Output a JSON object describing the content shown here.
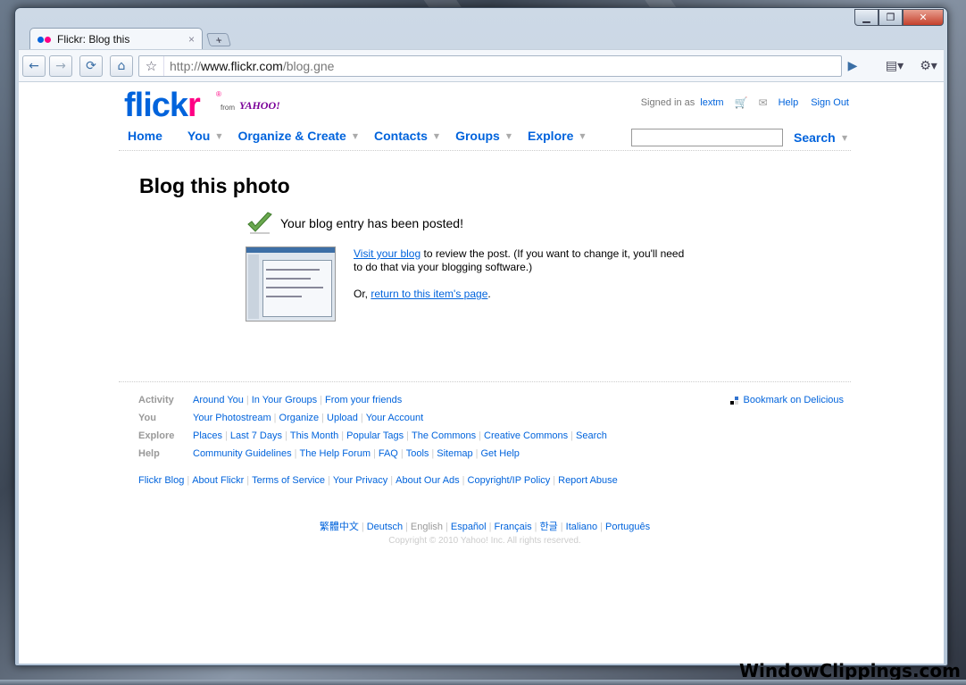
{
  "browser": {
    "tab_title": "Flickr: Blog this",
    "tab_close": "×",
    "new_tab": "+",
    "url_prefix": "http://",
    "url_host": "www.flickr.com",
    "url_path": "/blog.gne",
    "win_min": "▁",
    "win_max": "❐",
    "win_close": "✕",
    "icons": {
      "back": "←",
      "forward": "→",
      "reload": "⟳",
      "home": "⌂",
      "star": "☆",
      "go": "▶",
      "page": "▤▾",
      "wrench": "⚙▾"
    }
  },
  "header": {
    "logo_main": "flick",
    "logo_r": "r",
    "logo_reg": "®",
    "logo_from": "from",
    "logo_yahoo": "YAHOO!",
    "signed_in_as": "Signed in as",
    "username": "lextm",
    "help": "Help",
    "sign_out": "Sign Out",
    "cart_icon": "🛒",
    "mail_icon": "✉"
  },
  "nav": {
    "home": "Home",
    "you": "You",
    "organize": "Organize & Create",
    "contacts": "Contacts",
    "groups": "Groups",
    "explore": "Explore",
    "search": "Search",
    "caret": "▼"
  },
  "main": {
    "title": "Blog this photo",
    "posted": "Your blog entry has been posted!",
    "visit_link": "Visit your blog",
    "visit_rest": " to review the post. (If you want to change it, you'll need to do that via your blogging software.)",
    "or_text": "Or, ",
    "return_link": "return to this item's page",
    "period": "."
  },
  "footer": {
    "rows": [
      {
        "label": "Activity",
        "links": [
          "Around You",
          "In Your Groups",
          "From your friends"
        ]
      },
      {
        "label": "You",
        "links": [
          "Your Photostream",
          "Organize",
          "Upload",
          "Your Account"
        ]
      },
      {
        "label": "Explore",
        "links": [
          "Places",
          "Last 7 Days",
          "This Month",
          "Popular Tags",
          "The Commons",
          "Creative Commons",
          "Search"
        ]
      },
      {
        "label": "Help",
        "links": [
          "Community Guidelines",
          "The Help Forum",
          "FAQ",
          "Tools",
          "Sitemap",
          "Get Help"
        ]
      }
    ],
    "delicious": "Bookmark on Delicious",
    "bottom_links": [
      "Flickr Blog",
      "About Flickr",
      "Terms of Service",
      "Your Privacy",
      "About Our Ads",
      "Copyright/IP Policy",
      "Report Abuse"
    ],
    "languages": [
      "繁體中文",
      "Deutsch",
      "English",
      "Español",
      "Français",
      "한글",
      "Italiano",
      "Português"
    ],
    "current_language": "English",
    "copyright": "Copyright © 2010 Yahoo! Inc. All rights reserved."
  },
  "watermark": "WindowClippings.com",
  "colors": {
    "flickr_blue": "#0063dc",
    "flickr_pink": "#ff0084",
    "yahoo_purple": "#7b0099",
    "check_green": "#6aa84f"
  }
}
